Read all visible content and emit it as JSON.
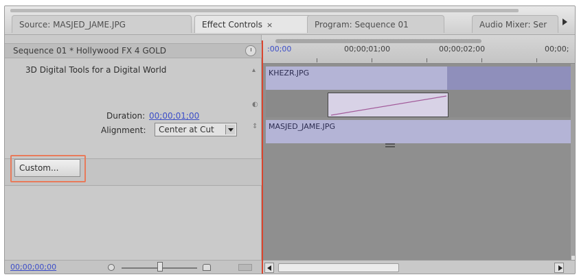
{
  "tabs": [
    {
      "label": "Source: MASJED_JAME.JPG"
    },
    {
      "label": "Effect Controls",
      "close": "×",
      "active": true
    },
    {
      "label": "Program: Sequence 01"
    },
    {
      "label": "Audio Mixer: Ser"
    }
  ],
  "left_panel": {
    "header": "Sequence 01 * Hollywood FX 4 GOLD",
    "description": "3D Digital Tools for a Digital World",
    "duration_label": "Duration:",
    "duration_value": "00;00;01;00",
    "alignment_label": "Alignment:",
    "alignment_value": "Center at Cut",
    "custom_button": "Custom...",
    "footer_timecode": "00;00;00;00"
  },
  "timeline": {
    "ruler_ticks": [
      ":00;00",
      "00;00;01;00",
      "00;00;02;00",
      "00;00;"
    ],
    "clip_a": "KHEZR.JPG",
    "clip_b": "MASJED_JAME.JPG"
  },
  "colors": {
    "accent_highlight": "#e87a5a",
    "playhead": "#d9452e",
    "clip": "#b4b4d6",
    "link": "#3b4dc8"
  },
  "icons": {
    "clock": "clock-icon",
    "dropdown": "chevron-down-icon",
    "zoom_out": "zoom-out-icon",
    "zoom_in": "zoom-in-icon",
    "scroll_left": "arrow-left-icon",
    "scroll_right": "arrow-right-icon",
    "panel_menu": "arrow-right-icon"
  }
}
